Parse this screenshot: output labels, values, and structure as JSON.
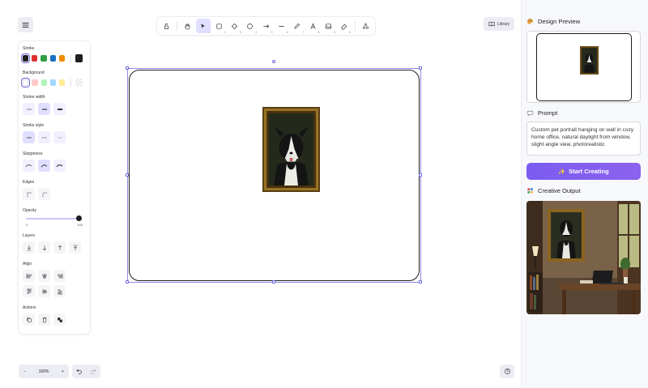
{
  "toolbar": {
    "tools": [
      {
        "name": "lock",
        "num": ""
      },
      {
        "name": "hand",
        "num": ""
      },
      {
        "name": "selection",
        "num": "1"
      },
      {
        "name": "rectangle",
        "num": "2"
      },
      {
        "name": "diamond",
        "num": "3"
      },
      {
        "name": "ellipse",
        "num": "4"
      },
      {
        "name": "arrow",
        "num": "5"
      },
      {
        "name": "line",
        "num": "6"
      },
      {
        "name": "draw",
        "num": "7"
      },
      {
        "name": "text",
        "num": "8"
      },
      {
        "name": "image",
        "num": "9"
      },
      {
        "name": "eraser",
        "num": "0"
      },
      {
        "name": "more-tools",
        "num": ""
      }
    ],
    "active_tool": "selection"
  },
  "library": {
    "label": "Library"
  },
  "properties": {
    "stroke": {
      "title": "Stroke",
      "colors": [
        "#1e1e1e",
        "#e03131",
        "#2f9e44",
        "#1971c2",
        "#f08c00"
      ],
      "selected": "#1e1e1e",
      "current": "#1e1e1e"
    },
    "background": {
      "title": "Background",
      "colors": [
        "transparent",
        "#ffc9c9",
        "#b2f2bb",
        "#a5d8ff",
        "#ffec99"
      ],
      "selected": "transparent"
    },
    "stroke_width": {
      "title": "Stroke width"
    },
    "stroke_style": {
      "title": "Stroke style"
    },
    "sloppiness": {
      "title": "Sloppiness"
    },
    "edges": {
      "title": "Edges"
    },
    "opacity": {
      "title": "Opacity",
      "min": "0",
      "max": "100",
      "value": 100
    },
    "layers": {
      "title": "Layers"
    },
    "align": {
      "title": "Align"
    },
    "actions": {
      "title": "Actions"
    }
  },
  "zoom": {
    "label": "100%",
    "minus": "−",
    "plus": "+"
  },
  "right_panel": {
    "design_preview_title": "Design Preview",
    "prompt_title": "Prompt",
    "prompt_text": "Custom pet portrait hanging on wall in cozy home office, natural daylight from window, slight angle view, photorealistic",
    "start_label": "Start Creating",
    "creative_output_title": "Creative Output"
  },
  "colors": {
    "accent": "#6965db",
    "button_gradient_start": "#7b5cf0",
    "button_gradient_end": "#8b62ee"
  }
}
